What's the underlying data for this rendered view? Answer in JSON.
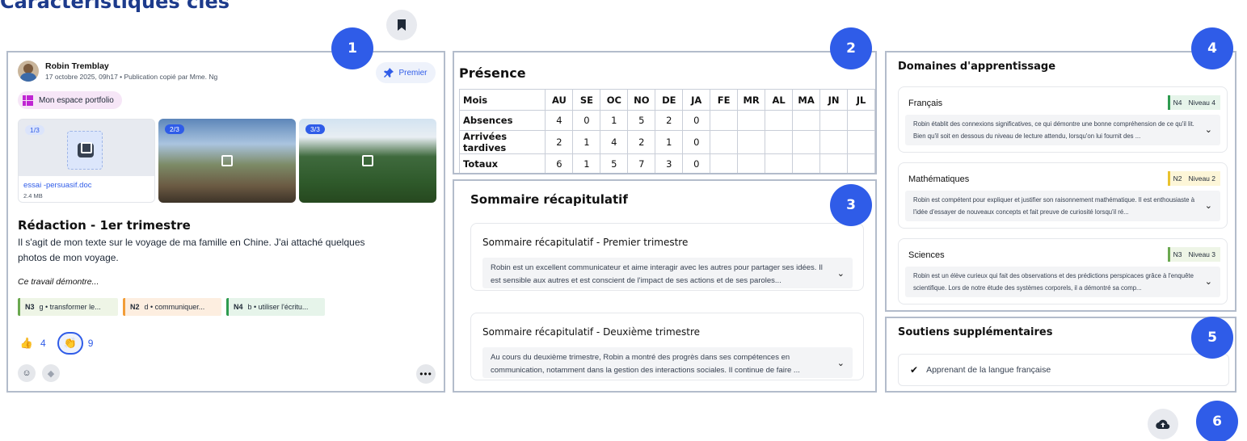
{
  "page": {
    "title": "Caractéristiques clés"
  },
  "badges": [
    "1",
    "2",
    "3",
    "4",
    "5",
    "6"
  ],
  "post": {
    "author": "Robin Tremblay",
    "meta": "17 octobre 2025, 09h17 • Publication copié par Mme. Ng",
    "premier_label": "Premier",
    "portfolio_label": "Mon espace portfolio",
    "attachments": [
      {
        "counter": "1/3",
        "name": "essai -persuasif.doc",
        "size": "2.4 MB"
      },
      {
        "counter": "2/3"
      },
      {
        "counter": "3/3"
      }
    ],
    "title": "Rédaction - 1er trimestre",
    "body": "Il s'agit de mon texte sur le voyage de ma famille en Chine. J'ai attaché quelques photos de mon voyage.",
    "demonstrates_label": "Ce travail démontre...",
    "tags": [
      {
        "level": "N3",
        "text": "g • transformer le..."
      },
      {
        "level": "N2",
        "text": "d • communiquer..."
      },
      {
        "level": "N4",
        "text": "b • utiliser l'écritu..."
      }
    ],
    "reactions": [
      {
        "emoji": "👍",
        "count": "4"
      },
      {
        "emoji": "👏",
        "count": "9"
      }
    ],
    "more_label": "•••"
  },
  "attendance": {
    "title": "Présence",
    "columns": [
      "Mois",
      "AU",
      "SE",
      "OC",
      "NO",
      "DE",
      "JA",
      "FE",
      "MR",
      "AL",
      "MA",
      "JN",
      "JL"
    ],
    "rows": [
      {
        "label": "Absences",
        "values": [
          "4",
          "0",
          "1",
          "5",
          "2",
          "0",
          "",
          "",
          "",
          "",
          "",
          ""
        ]
      },
      {
        "label": "Arrivées tardives",
        "values": [
          "2",
          "1",
          "4",
          "2",
          "1",
          "0",
          "",
          "",
          "",
          "",
          "",
          ""
        ]
      },
      {
        "label": "Totaux",
        "values": [
          "6",
          "1",
          "5",
          "7",
          "3",
          "0",
          "",
          "",
          "",
          "",
          "",
          ""
        ]
      }
    ]
  },
  "summary": {
    "title": "Sommaire récapitulatif",
    "items": [
      {
        "title": "Sommaire récapitulatif - Premier trimestre",
        "text": "Robin est un excellent communicateur et aime interagir avec les autres pour partager ses idées. Il est sensible aux autres et est conscient de l'impact de ses actions et de ses paroles..."
      },
      {
        "title": "Sommaire récapitulatif - Deuxième trimestre",
        "text": "Au cours du deuxième trimestre, Robin a montré des progrès dans ses compétences en communication, notamment dans la gestion des interactions sociales. Il continue de faire ..."
      }
    ]
  },
  "domains": {
    "title": "Domaines d'apprentissage",
    "items": [
      {
        "name": "Français",
        "level": "N4",
        "level_label": "Niveau 4",
        "color": "#2e9b4f",
        "bg": "#e6f4ea",
        "text": "Robin établit des connexions significatives, ce qui démontre une bonne compréhension de ce qu'il lit. Bien qu'il soit en dessous du niveau de lecture attendu, lorsqu'on lui fournit des ..."
      },
      {
        "name": "Mathématiques",
        "level": "N2",
        "level_label": "Niveau 2",
        "color": "#e9c22e",
        "bg": "#fdf6d8",
        "text": "Robin est compétent pour expliquer et justifier son raisonnement mathématique. Il est enthousiaste à l'idée d'essayer de nouveaux concepts et fait preuve de curiosité lorsqu'il ré..."
      },
      {
        "name": "Sciences",
        "level": "N3",
        "level_label": "Niveau 3",
        "color": "#6aa84f",
        "bg": "#eef5e6",
        "text": "Robin est un élève curieux qui fait des observations et des prédictions perspicaces grâce à l'enquête scientifique. Lors de notre étude des systèmes corporels, il a démontré sa comp..."
      }
    ]
  },
  "supports": {
    "title": "Soutiens supplémentaires",
    "items": [
      "Apprenant de la langue française"
    ]
  },
  "colors": {
    "accent": "#2f5ce8",
    "title": "#1d3b8c",
    "panel_border": "#b3bccb"
  }
}
